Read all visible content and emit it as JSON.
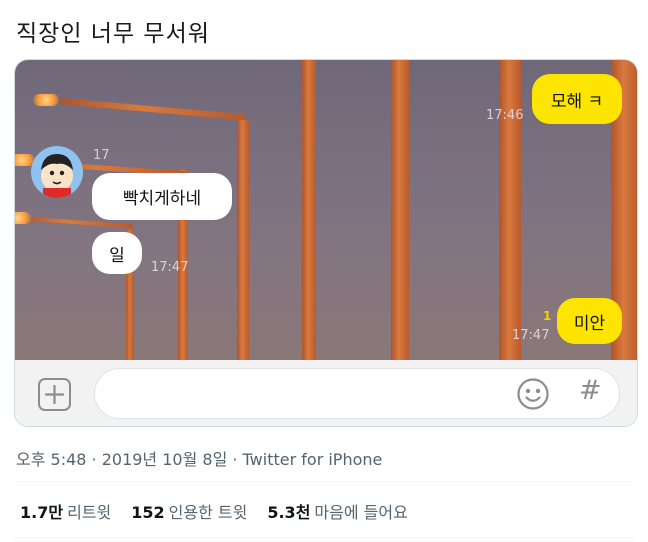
{
  "tweet": {
    "text": "직장인 너무 무서워"
  },
  "chat": {
    "messages": [
      {
        "text": "모해 ㅋ",
        "time": "17:46"
      },
      {
        "sender_name": "17",
        "text": "빡치게하네"
      },
      {
        "text": "일",
        "time": "17:47"
      },
      {
        "text": "미안",
        "time": "17:47",
        "unread": "1"
      }
    ],
    "input_bar": {
      "plus_icon": "plus-icon",
      "emoji_icon": "emoji-icon",
      "hash_icon": "hash-icon",
      "hash_glyph": "#"
    }
  },
  "meta": {
    "text": "오후 5:48 · 2019년 10월 8일 · Twitter for iPhone"
  },
  "stats": [
    {
      "count": "1.7만",
      "label": "리트윗"
    },
    {
      "count": "152",
      "label": "인용한 트윗"
    },
    {
      "count": "5.3천",
      "label": "마음에 들어요"
    }
  ],
  "colors": {
    "my_bubble": "#fee500",
    "their_bubble": "#ffffff",
    "meta_text": "#536471"
  }
}
